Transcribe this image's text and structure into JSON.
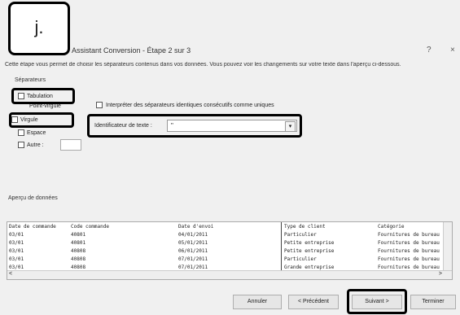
{
  "annotation_label": "j.",
  "dialog": {
    "title": "Assistant Conversion - Étape 2 sur 3",
    "help": "?",
    "close": "×",
    "instruction": "Cette étape vous permet de choisir les séparateurs contenus dans vos données. Vous pouvez voir les changements sur votre texte dans l'aperçu ci-dessous."
  },
  "separators": {
    "group_title": "Séparateurs",
    "options": [
      {
        "label": "Tabulation",
        "checked": false
      },
      {
        "label": "Point-virgule",
        "checked": false
      },
      {
        "label": "Virgule",
        "checked": false
      },
      {
        "label": "Espace",
        "checked": false
      },
      {
        "label": "Autre :",
        "checked": false
      }
    ],
    "consecutive_label": "Interpréter des séparateurs identiques consécutifs comme uniques",
    "qualifier_label": "Identificateur de texte :",
    "qualifier_value": "\"",
    "qualifier_arrow": "▾"
  },
  "preview": {
    "label": "Aperçu de données",
    "rows": [
      [
        "Date de commande",
        "Code commande",
        "Date d'envoi",
        "Type de client",
        "Catégorie"
      ],
      [
        "03/01",
        "40801",
        "04/01/2011",
        "Particulier",
        "Fournitures de bureau"
      ],
      [
        "03/01",
        "40801",
        "05/01/2011",
        "Petite entreprise",
        "Fournitures de bureau"
      ],
      [
        "03/01",
        "40808",
        "06/01/2011",
        "Petite entreprise",
        "Fournitures de bureau"
      ],
      [
        "03/01",
        "40808",
        "07/01/2011",
        "Particulier",
        "Fournitures de bureau"
      ],
      [
        "03/01",
        "40808",
        "07/01/2011",
        "Grande entreprise",
        "Fournitures de bureau"
      ]
    ],
    "scroll_left": "<",
    "scroll_right": ">"
  },
  "buttons": {
    "cancel": "Annuler",
    "previous": "< Précédent",
    "next": "Suivant >",
    "finish": "Terminer"
  }
}
